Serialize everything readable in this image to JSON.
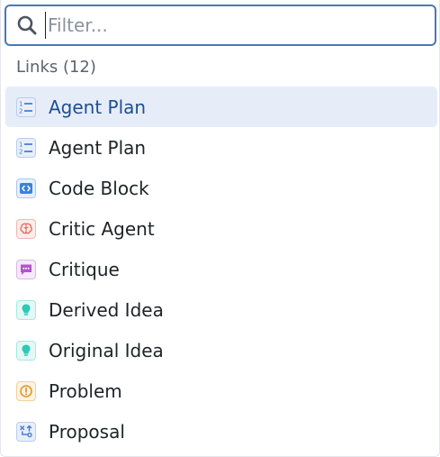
{
  "search": {
    "placeholder": "Filter...",
    "value": ""
  },
  "section": {
    "title": "Links (12)"
  },
  "items": [
    {
      "label": "Agent Plan",
      "icon": "numbered-list-icon",
      "selected": true
    },
    {
      "label": "Agent Plan",
      "icon": "numbered-list-icon",
      "selected": false
    },
    {
      "label": "Code Block",
      "icon": "code-icon",
      "selected": false
    },
    {
      "label": "Critic Agent",
      "icon": "brain-icon",
      "selected": false
    },
    {
      "label": "Critique",
      "icon": "comment-icon",
      "selected": false
    },
    {
      "label": "Derived Idea",
      "icon": "lightbulb-icon",
      "selected": false
    },
    {
      "label": "Original Idea",
      "icon": "lightbulb-icon",
      "selected": false
    },
    {
      "label": "Problem",
      "icon": "alert-circle-icon",
      "selected": false
    },
    {
      "label": "Proposal",
      "icon": "proposal-icon",
      "selected": false
    }
  ],
  "colors": {
    "focus_border": "#4a78b8",
    "selected_bg": "#e6edf8",
    "selected_text": "#1d4f91",
    "agent_plan": "#4a7fd1",
    "code_block": "#3b82d6",
    "critic_agent": "#e0685a",
    "critique": "#b255c9",
    "idea": "#2fc9b5",
    "problem": "#e09a2e",
    "proposal": "#4a7fd1"
  }
}
